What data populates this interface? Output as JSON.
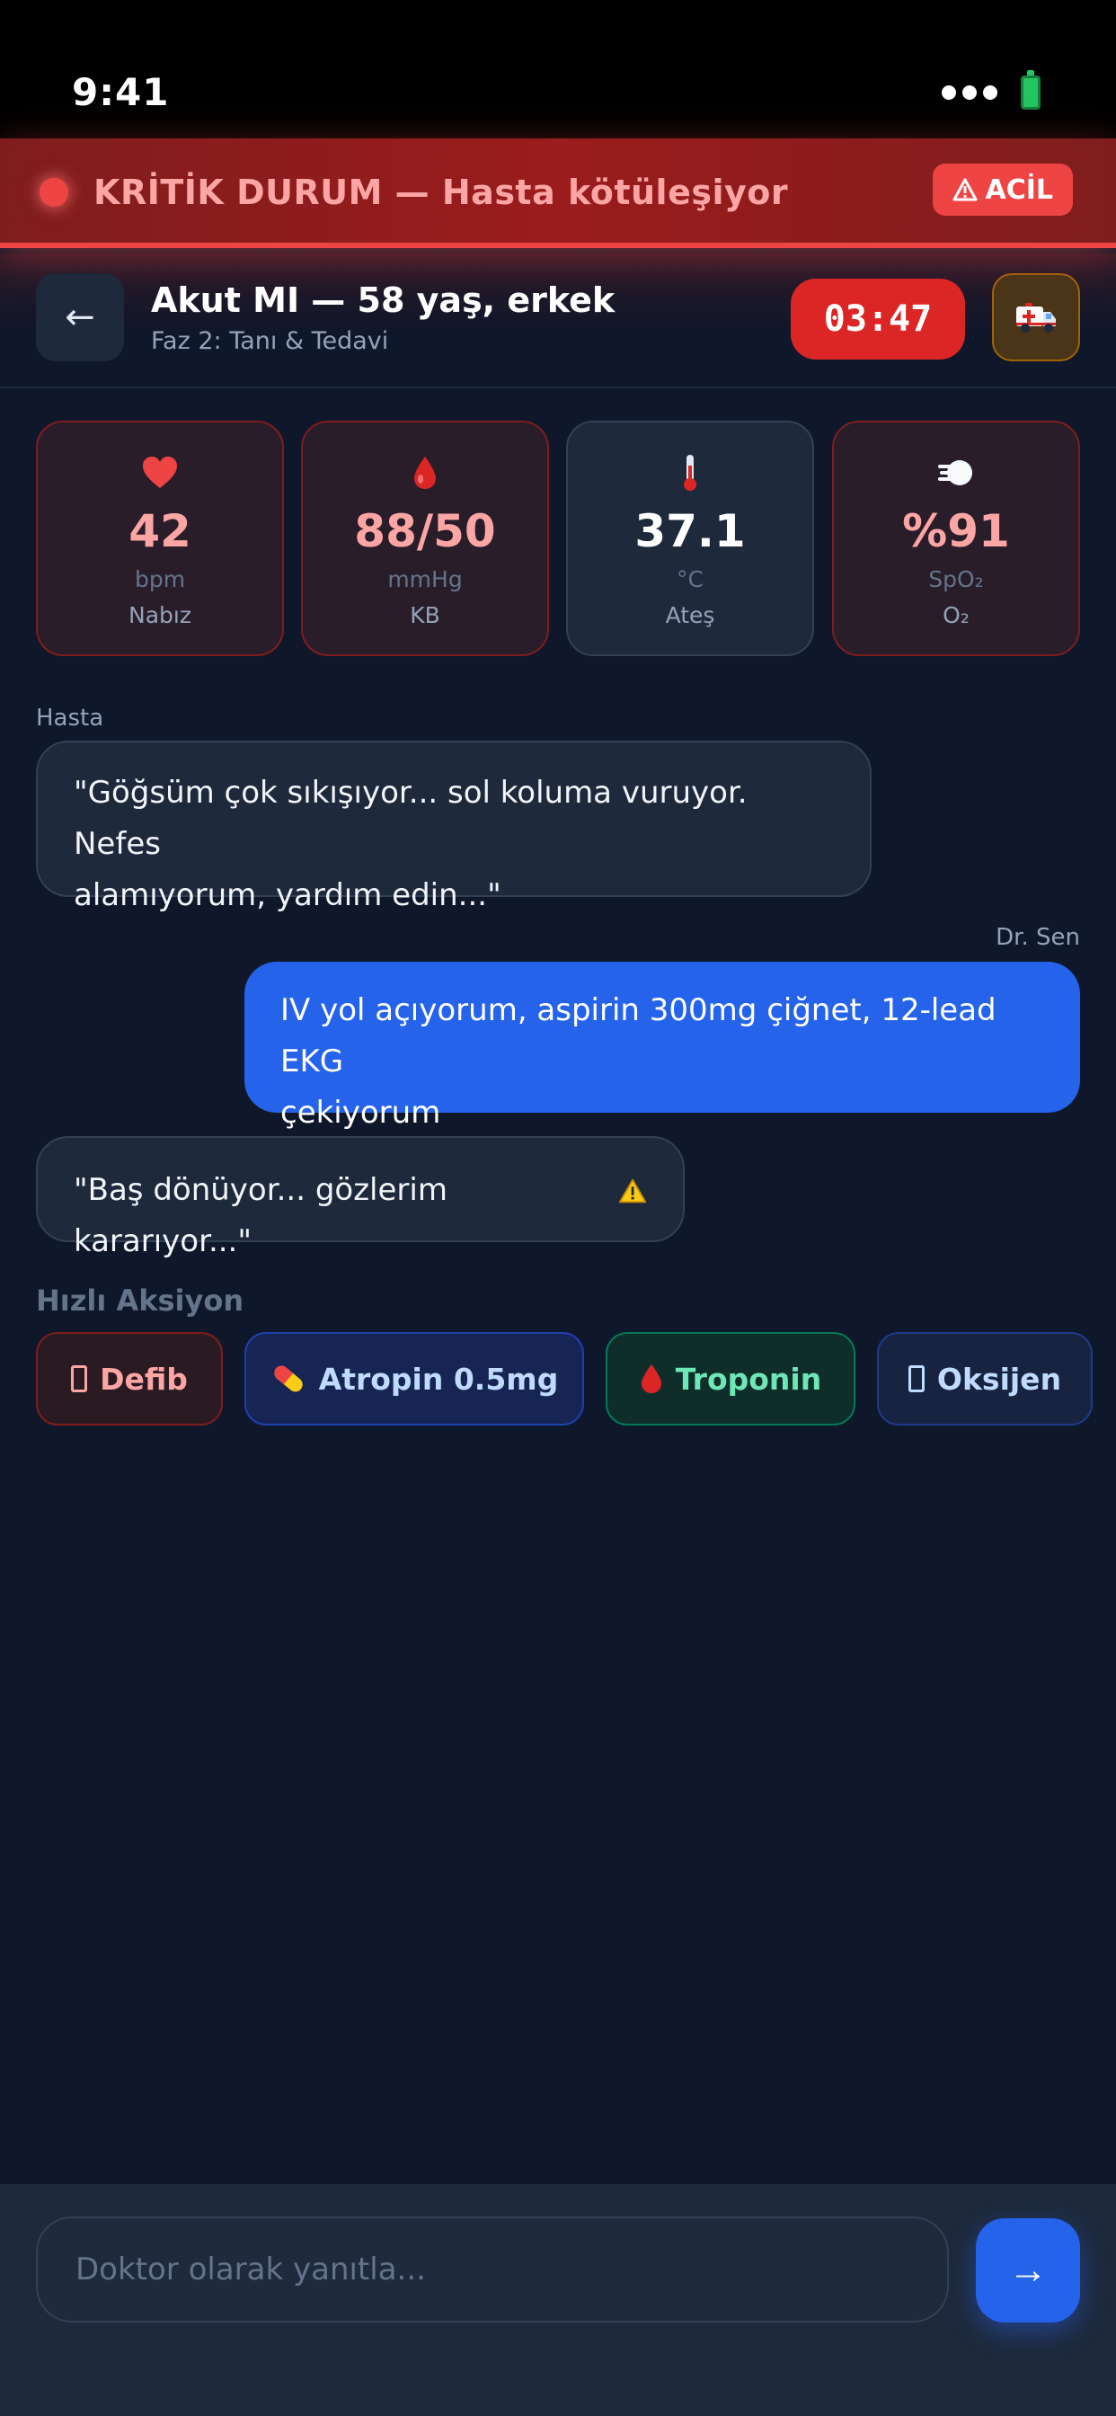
{
  "status_bar": {
    "time": "9:41"
  },
  "alert_banner": {
    "text": "KRİTİK DURUM — Hasta kötüleşiyor",
    "badge": "ACİL"
  },
  "header": {
    "back_icon": "←",
    "title": "Akut MI — 58 yaş, erkek",
    "subtitle": "Faz 2: Tanı & Tedavi",
    "timer": "03:47",
    "ambulance_icon": "ambulance-icon"
  },
  "vitals": [
    {
      "icon": "heart-icon",
      "value": "42",
      "unit": "bpm",
      "label": "Nabız",
      "status": "critical"
    },
    {
      "icon": "blood-drop-icon",
      "value": "88/50",
      "unit": "mmHg",
      "label": "KB",
      "status": "critical"
    },
    {
      "icon": "thermometer-icon",
      "value": "37.1",
      "unit": "°C",
      "label": "Ateş",
      "status": "normal"
    },
    {
      "icon": "wind-icon",
      "value": "%91",
      "unit": "SpO₂",
      "label": "O₂",
      "status": "critical"
    }
  ],
  "chat": {
    "patient_label": "Hasta",
    "doctor_label": "Dr. Sen",
    "messages": [
      {
        "sender": "patient",
        "lines": [
          "\"Göğsüm çok sıkışıyor... sol koluma vuruyor. Nefes",
          "alamıyorum, yardım edin...\""
        ]
      },
      {
        "sender": "doctor",
        "lines": [
          "IV yol açıyorum, aspirin 300mg çiğnet, 12-lead EKG",
          "çekiyorum"
        ]
      },
      {
        "sender": "patient",
        "lines": [
          "\"Baş dönüyor... gözlerim kararıyor...\""
        ],
        "icon": "warning-icon"
      }
    ]
  },
  "quick_actions": {
    "title": "Hızlı Aksiyon",
    "items": [
      {
        "label": "Defib",
        "icon": "missing-glyph-icon"
      },
      {
        "label": "Atropin 0.5mg",
        "icon": "pill-icon"
      },
      {
        "label": "Troponin",
        "icon": "blood-drop-icon"
      },
      {
        "label": "Oksijen",
        "icon": "missing-glyph-icon"
      }
    ]
  },
  "composer": {
    "placeholder": "Doktor olarak yanıtla...",
    "send_icon": "→"
  },
  "colors": {
    "background": "#0f172a",
    "critical": "#ef4444",
    "critical_text": "#fca5a5",
    "accent": "#2563eb",
    "card": "#1e293b"
  }
}
